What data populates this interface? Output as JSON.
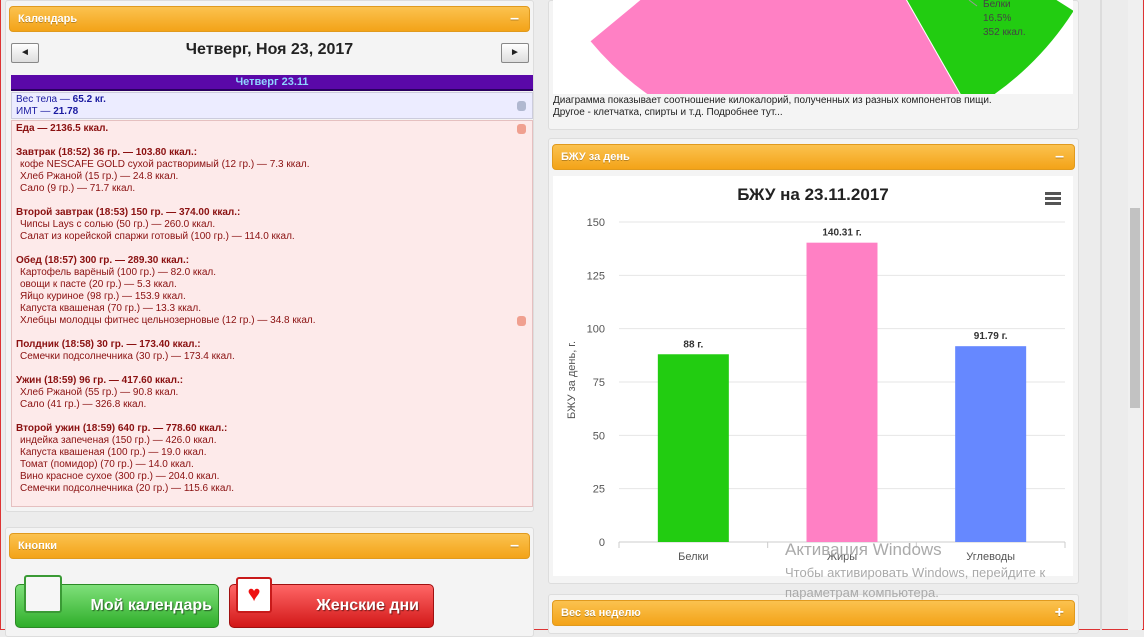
{
  "calendar": {
    "header": "Календарь",
    "collapse": "–",
    "prev_label": "◄",
    "next_label": "►",
    "date_title": "Четверг, Ноя 23, 2017",
    "day_bar": "Четверг 23.11",
    "weight": {
      "label": "Вес тела — ",
      "value": "65.2 кг.",
      "bmi_label": "ИМТ — ",
      "bmi_value": "21.78"
    },
    "food_total": "Еда — 2136.5 ккал.",
    "meals": [
      {
        "title": "Завтрак (18:52) 36 гр. — 103.80 ккал.:",
        "items": [
          "кофе NESCAFE GOLD сухой растворимый (12 гр.) — 7.3 ккал.",
          "Хлеб Ржаной (15 гр.) — 24.8 ккал.",
          "Сало (9 гр.) — 71.7 ккал."
        ]
      },
      {
        "title": "Второй завтрак (18:53) 150 гр. — 374.00 ккал.:",
        "items": [
          "Чипсы Lays с солью (50 гр.) — 260.0 ккал.",
          "Салат из корейской спаржи готовый (100 гр.) — 114.0 ккал."
        ]
      },
      {
        "title": "Обед (18:57) 300 гр. — 289.30 ккал.:",
        "items": [
          "Картофель варёный (100 гр.) — 82.0 ккал.",
          "овощи к пасте (20 гр.) — 5.3 ккал.",
          "Яйцо куриное (98 гр.) — 153.9 ккал.",
          "Капуста квашеная (70 гр.) — 13.3 ккал.",
          "Хлебцы молодцы фитнес цельнозерновые (12 гр.) — 34.8 ккал."
        ]
      },
      {
        "title": "Полдник (18:58) 30 гр. — 173.40 ккал.:",
        "items": [
          "Семечки подсолнечника (30 гр.) — 173.4 ккал."
        ]
      },
      {
        "title": "Ужин (18:59) 96 гр. — 417.60 ккал.:",
        "items": [
          "Хлеб Ржаной (55 гр.) — 90.8 ккал.",
          "Сало (41 гр.) — 326.8 ккал."
        ]
      },
      {
        "title": "Второй ужин (18:59) 640 гр. — 778.60 ккал.:",
        "items": [
          "индейка запеченая (150 гр.) — 426.0 ккал.",
          "Капуста квашеная (100 гр.) — 19.0 ккал.",
          "Томат (помидор) (70 гр.) — 14.0 ккал.",
          "Вино красное сухое (300 гр.) — 204.0 ккал.",
          "Семечки подсолнечника (20 гр.) — 115.6 ккал."
        ]
      }
    ]
  },
  "buttons_panel": {
    "header": "Кнопки",
    "collapse": "–",
    "my_calendar": "Мой календарь",
    "womens_days": "Женские дни"
  },
  "pie": {
    "legend_name": "Белки",
    "legend_percent": "16.5%",
    "legend_kcal": "352 ккал.",
    "caption_line1": "Диаграмма показывает соотношение килокалорий, полученных из разных компонентов пищи.",
    "caption_line2": "Другое - клетчатка, спирты и т.д. Подробнее тут...",
    "colors": {
      "pink": "#ff80c4",
      "green": "#22cc11"
    }
  },
  "bju_panel": {
    "header": "БЖУ за день",
    "collapse": "–"
  },
  "weight_week_panel": {
    "header": "Вес за неделю",
    "expand": "+"
  },
  "watermark": {
    "title": "Активация Windows",
    "line1": "Чтобы активировать Windows, перейдите к",
    "line2": "параметрам компьютера."
  },
  "chart_data": {
    "type": "bar",
    "title": "БЖУ на 23.11.2017",
    "ylabel": "БЖУ за день, г.",
    "xlabel": "",
    "categories": [
      "Белки",
      "Жиры",
      "Углеводы"
    ],
    "values": [
      88,
      140.31,
      91.79
    ],
    "data_labels": [
      "88 г.",
      "140.31 г.",
      "91.79 г."
    ],
    "colors": [
      "#22cc11",
      "#ff80c4",
      "#6688ff"
    ],
    "ylim": [
      0,
      150
    ],
    "yticks": [
      0,
      25,
      50,
      75,
      100,
      125,
      150
    ],
    "grid": true,
    "legend": "none"
  }
}
